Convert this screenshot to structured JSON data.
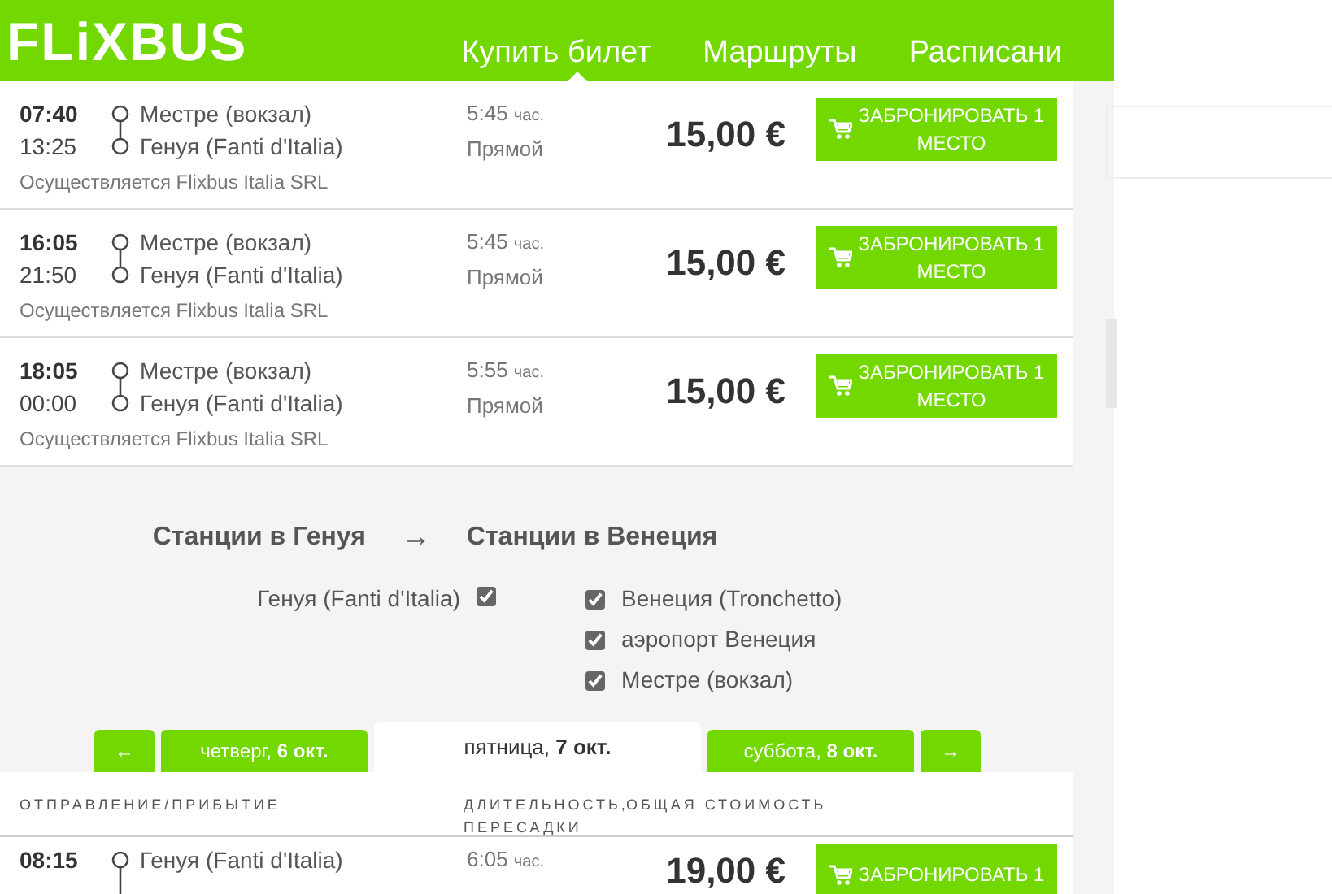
{
  "header": {
    "logo": "FLiXBUS",
    "nav": [
      {
        "label": "Купить билет",
        "selected": true
      },
      {
        "label": "Маршруты",
        "selected": false
      },
      {
        "label": "Расписани",
        "selected": false
      }
    ]
  },
  "trips": [
    {
      "departure": "07:40",
      "arrival": "13:25",
      "from": "Местре (вокзал)",
      "to": "Генуя (Fanti d'Italia)",
      "duration": "5:45",
      "duration_unit": "час.",
      "transfer": "Прямой",
      "operator": "Осуществляется Flixbus Italia SRL",
      "price": "15,00 €",
      "button": "ЗАБРОНИРОВАТЬ 1 МЕСТО"
    },
    {
      "departure": "16:05",
      "arrival": "21:50",
      "from": "Местре (вокзал)",
      "to": "Генуя (Fanti d'Italia)",
      "duration": "5:45",
      "duration_unit": "час.",
      "transfer": "Прямой",
      "operator": "Осуществляется Flixbus Italia SRL",
      "price": "15,00 €",
      "button": "ЗАБРОНИРОВАТЬ 1 МЕСТО"
    },
    {
      "departure": "18:05",
      "arrival": "00:00",
      "from": "Местре (вокзал)",
      "to": "Генуя (Fanti d'Italia)",
      "duration": "5:55",
      "duration_unit": "час.",
      "transfer": "Прямой",
      "operator": "Осуществляется Flixbus Italia SRL",
      "price": "15,00 €",
      "button": "ЗАБРОНИРОВАТЬ 1 МЕСТО"
    }
  ],
  "stations": {
    "from_title": "Станции в Генуя",
    "arrow": "→",
    "to_title": "Станции в Венеция",
    "from": [
      {
        "label": "Генуя (Fanti d'Italia)",
        "checked": true
      }
    ],
    "to": [
      {
        "label": "Венеция (Tronchetto)",
        "checked": true
      },
      {
        "label": "аэропорт Венеция",
        "checked": true
      },
      {
        "label": "Местре (вокзал)",
        "checked": true
      }
    ]
  },
  "day_tabs": {
    "prev": "←",
    "days": [
      {
        "label": "четверг, **6 окт.**",
        "selected": false
      },
      {
        "label": "пятница, **7 окт.**",
        "selected": true
      },
      {
        "label": "суббота, **8 окт.**",
        "selected": false
      }
    ],
    "next": "→"
  },
  "table": {
    "columns": [
      "ОТПРАВЛЕНИЕ/ПРИБЫТИЕ",
      "ДЛИТЕЛЬНОСТЬ, ПЕРЕСАДКИ",
      "ОБЩАЯ СТОИМОСТЬ"
    ],
    "rows": [
      {
        "departure": "08:15",
        "from": "Генуя (Fanti d'Italia)",
        "duration": "6:05",
        "duration_unit": "час.",
        "price": "19,00 €",
        "button": "ЗАБРОНИРОВАТЬ 1"
      }
    ]
  }
}
